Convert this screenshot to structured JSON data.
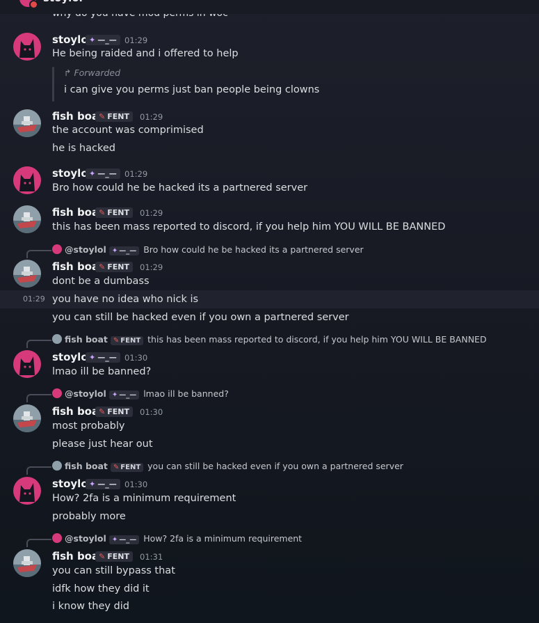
{
  "top": {
    "peek_name": "stoylol",
    "peek_message": "why do you have mod perms in woc"
  },
  "tags": {
    "stoylol": "—_—",
    "fishboat": "FENT"
  },
  "icons": {
    "stoylol_tag_icon": "sparkle-icon",
    "fishboat_tag_icon": "syringe-icon",
    "forward_icon": "forward-arrow-icon"
  },
  "colors": {
    "stoylol_avatar": "#d63a7b",
    "fishboat_avatar": "#7a8a96",
    "background": "#161922"
  },
  "messages": [
    {
      "author": "stoylol",
      "time": "01:29",
      "lines": [
        "He being raided and i offered to help"
      ],
      "forwarded_label": "Forwarded",
      "forwarded_text": "i can give you perms just ban people being clowns"
    },
    {
      "author": "fish boat",
      "time": "01:29",
      "lines": [
        "the account was comprimised",
        "he is hacked"
      ]
    },
    {
      "author": "stoylol",
      "time": "01:29",
      "lines": [
        "Bro how could he be hacked its a partnered server"
      ]
    },
    {
      "author": "fish boat",
      "time": "01:29",
      "lines": [
        "this has been mass reported to discord, if you help him YOU WILL BE BANNED"
      ]
    },
    {
      "author": "fish boat",
      "time": "01:29",
      "side_time": "01:29",
      "reply": {
        "name": "@stoylol",
        "text": "Bro how could he be hacked its a partnered server"
      },
      "lines": [
        "dont be a dumbass",
        "you have no idea who nick is",
        "you can still be hacked even if you own a partnered server"
      ]
    },
    {
      "author": "stoylol",
      "time": "01:30",
      "reply": {
        "name": "fish boat",
        "text": "this has been mass reported to discord, if you help him YOU WILL BE BANNED"
      },
      "lines": [
        "lmao ill be banned?"
      ]
    },
    {
      "author": "fish boat",
      "time": "01:30",
      "reply": {
        "name": "@stoylol",
        "text": "lmao ill be banned?"
      },
      "lines": [
        "most probably",
        "please just hear out"
      ]
    },
    {
      "author": "stoylol",
      "time": "01:30",
      "reply": {
        "name": "fish boat",
        "text": "you can still be hacked even if you own a partnered server"
      },
      "lines": [
        "How? 2fa is a minimum requirement",
        "probably more"
      ]
    },
    {
      "author": "fish boat",
      "time": "01:31",
      "reply": {
        "name": "@stoylol",
        "text": "How? 2fa is a minimum requirement"
      },
      "lines": [
        "you can still bypass that",
        "idfk how they did it",
        "i know they did"
      ]
    }
  ]
}
